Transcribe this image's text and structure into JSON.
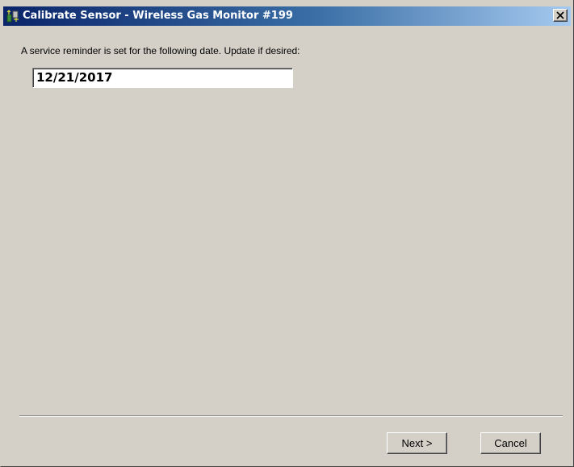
{
  "window": {
    "title": "Calibrate Sensor - Wireless Gas Monitor #199",
    "icon": "sensor-app-icon",
    "close_icon": "close-icon"
  },
  "body": {
    "prompt": "A service reminder is set for the following date.  Update if desired:",
    "reminder_date": "12/21/2017"
  },
  "buttons": {
    "next_label": "Next >",
    "cancel_label": "Cancel"
  },
  "colors": {
    "dialog_face": "#d4d0c8",
    "titlebar_start": "#0a246a",
    "titlebar_end": "#a6caf0"
  }
}
